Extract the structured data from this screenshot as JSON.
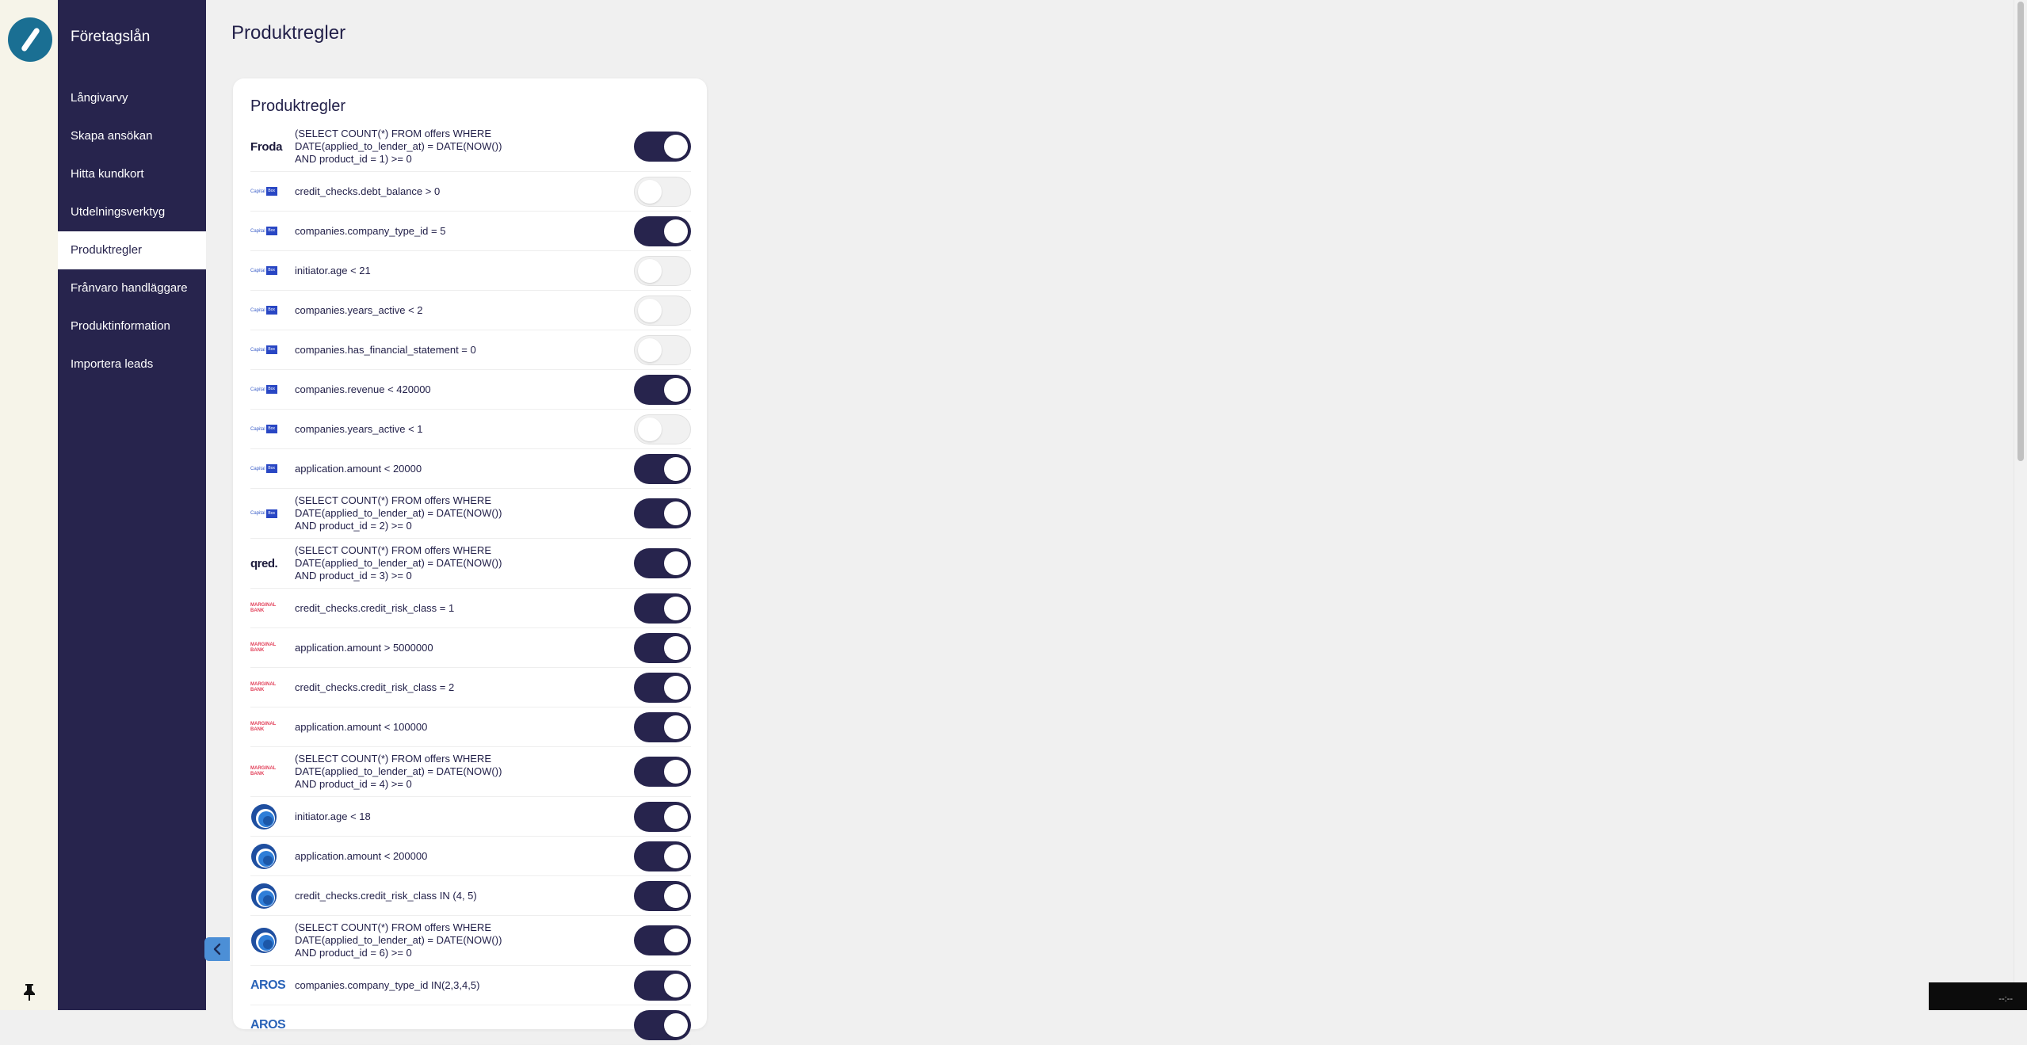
{
  "sidebar": {
    "app_title": "Företagslån",
    "items": [
      {
        "label": "Långivarvy",
        "active": false
      },
      {
        "label": "Skapa ansökan",
        "active": false
      },
      {
        "label": "Hitta kundkort",
        "active": false
      },
      {
        "label": "Utdelningsverktyg",
        "active": false
      },
      {
        "label": "Produktregler",
        "active": true
      },
      {
        "label": "Frånvaro handläggare",
        "active": false
      },
      {
        "label": "Produktinformation",
        "active": false
      },
      {
        "label": "Importera leads",
        "active": false
      }
    ]
  },
  "page": {
    "title": "Produktregler"
  },
  "card": {
    "title": "Produktregler"
  },
  "logo_text": {
    "froda": "Froda",
    "capitalbox_small": "Capital",
    "capitalbox_box": "Box",
    "qred": "qred.",
    "marginal_line1": "MARGINAL",
    "marginal_line2": "BANK",
    "aros": "AROS"
  },
  "rules": [
    {
      "logo": "froda",
      "text": "(SELECT COUNT(*) FROM offers WHERE\nDATE(applied_to_lender_at) = DATE(NOW())\nAND product_id = 1) >= 0",
      "enabled": true,
      "lines": 3
    },
    {
      "logo": "capitalbox",
      "text": "credit_checks.debt_balance > 0",
      "enabled": false,
      "lines": 1
    },
    {
      "logo": "capitalbox",
      "text": "companies.company_type_id = 5",
      "enabled": true,
      "lines": 1
    },
    {
      "logo": "capitalbox",
      "text": "initiator.age < 21",
      "enabled": false,
      "lines": 1
    },
    {
      "logo": "capitalbox",
      "text": "companies.years_active < 2",
      "enabled": false,
      "lines": 1
    },
    {
      "logo": "capitalbox",
      "text": "companies.has_financial_statement = 0",
      "enabled": false,
      "lines": 1
    },
    {
      "logo": "capitalbox",
      "text": "companies.revenue < 420000",
      "enabled": true,
      "lines": 1
    },
    {
      "logo": "capitalbox",
      "text": "companies.years_active < 1",
      "enabled": false,
      "lines": 1
    },
    {
      "logo": "capitalbox",
      "text": "application.amount < 20000",
      "enabled": true,
      "lines": 1
    },
    {
      "logo": "capitalbox",
      "text": "(SELECT COUNT(*) FROM offers WHERE\nDATE(applied_to_lender_at) = DATE(NOW())\nAND product_id = 2) >= 0",
      "enabled": true,
      "lines": 3
    },
    {
      "logo": "qred",
      "text": "(SELECT COUNT(*) FROM offers WHERE\nDATE(applied_to_lender_at) = DATE(NOW())\nAND product_id = 3) >= 0",
      "enabled": true,
      "lines": 3
    },
    {
      "logo": "marginal",
      "text": "credit_checks.credit_risk_class = 1",
      "enabled": true,
      "lines": 1
    },
    {
      "logo": "marginal",
      "text": "application.amount > 5000000",
      "enabled": true,
      "lines": 1
    },
    {
      "logo": "marginal",
      "text": "credit_checks.credit_risk_class = 2",
      "enabled": true,
      "lines": 1
    },
    {
      "logo": "marginal",
      "text": "application.amount < 100000",
      "enabled": true,
      "lines": 1
    },
    {
      "logo": "marginal",
      "text": "(SELECT COUNT(*) FROM offers WHERE\nDATE(applied_to_lender_at) = DATE(NOW())\nAND product_id = 4) >= 0",
      "enabled": true,
      "lines": 3
    },
    {
      "logo": "circle",
      "text": "initiator.age < 18",
      "enabled": true,
      "lines": 1
    },
    {
      "logo": "circle",
      "text": "application.amount < 200000",
      "enabled": true,
      "lines": 1
    },
    {
      "logo": "circle",
      "text": "credit_checks.credit_risk_class IN (4, 5)",
      "enabled": true,
      "lines": 1
    },
    {
      "logo": "circle",
      "text": "(SELECT COUNT(*) FROM offers WHERE\nDATE(applied_to_lender_at) = DATE(NOW())\nAND product_id = 6) >= 0",
      "enabled": true,
      "lines": 3
    },
    {
      "logo": "aros",
      "text": "companies.company_type_id IN(2,3,4,5)",
      "enabled": true,
      "lines": 1
    },
    {
      "logo": "aros",
      "text": "",
      "enabled": true,
      "lines": 1
    }
  ],
  "overlay": {
    "clock": "--:--"
  },
  "colors": {
    "sidebar": "#27244d",
    "toggle_on": "#27244d",
    "toggle_off": "#f1f1f1",
    "rail": "#f6f4e9",
    "logo_circle": "#1a6f93",
    "collapse_button": "#4c8fd6"
  }
}
